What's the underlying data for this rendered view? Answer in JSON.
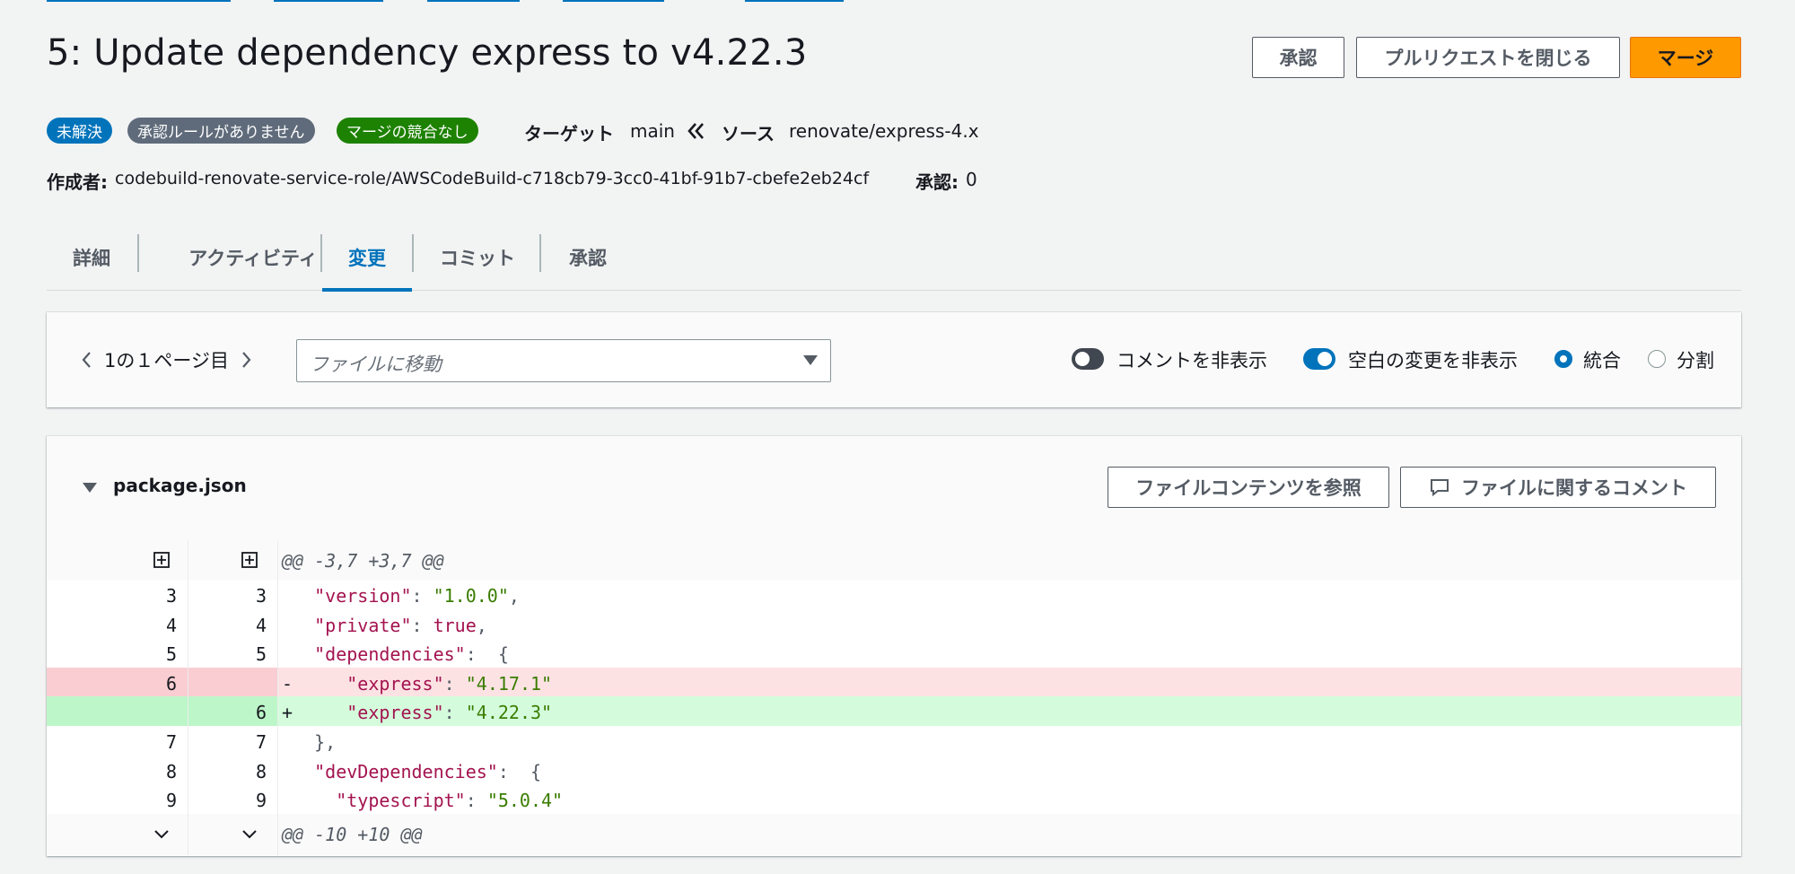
{
  "title": "5: Update dependency express to v4.22.3",
  "actions": {
    "approve": "承認",
    "close_pr": "プルリクエストを閉じる",
    "merge": "マージ"
  },
  "status": {
    "badges": [
      {
        "label": "未解決",
        "color": "#0073bb"
      },
      {
        "label": "承認ルールがありません",
        "color": "#5f6b7a"
      },
      {
        "label": "マージの競合なし",
        "color": "#1d8102"
      }
    ],
    "target_label": "ターゲット",
    "target_branch": "main",
    "source_label": "ソース",
    "source_branch": "renovate/express-4.x",
    "author_label": "作成者:",
    "author": "codebuild-renovate-service-role/AWSCodeBuild-c718cb79-3cc0-41bf-91b7-cbefe2eb24cf",
    "approvals_label": "承認:",
    "approvals_count": "0"
  },
  "tabs": [
    "詳細",
    "アクティビティ",
    "変更",
    "コミット",
    "承認"
  ],
  "active_tab": "変更",
  "toolbar": {
    "pager": "1の１ページ目",
    "file_select_placeholder": "ファイルに移動",
    "hide_comments": {
      "label": "コメントを非表示",
      "on": false
    },
    "hide_whitespace": {
      "label": "空白の変更を非表示",
      "on": true
    },
    "view_unified": "統合",
    "view_split": "分割",
    "selected_view": "統合"
  },
  "file": {
    "name": "package.json",
    "browse_button": "ファイルコンテンツを参照",
    "comment_button": "ファイルに関するコメント"
  },
  "diff": {
    "hunk_header": "@@ -3,7 +3,7 @@",
    "hunk_footer": "@@ -10 +10 @@",
    "lines": [
      {
        "type": "context",
        "old": "3",
        "new": "3",
        "marker": "",
        "indent": "  ",
        "key": "\"version\"",
        "value": "\"1.0.0\"",
        "tail": ","
      },
      {
        "type": "context",
        "old": "4",
        "new": "4",
        "marker": "",
        "indent": "  ",
        "key": "\"private\"",
        "value": "true",
        "tail": ","
      },
      {
        "type": "context",
        "old": "5",
        "new": "5",
        "marker": "",
        "indent": "  ",
        "key": "\"dependencies\"",
        "value": "",
        "tail": "{"
      },
      {
        "type": "del",
        "old": "6",
        "new": "",
        "marker": "-",
        "indent": "    ",
        "key": "\"express\"",
        "value": "\"4.17.1\"",
        "tail": ""
      },
      {
        "type": "add",
        "old": "",
        "new": "6",
        "marker": "+",
        "indent": "    ",
        "key": "\"express\"",
        "value": "\"4.22.3\"",
        "tail": ""
      },
      {
        "type": "context",
        "old": "7",
        "new": "7",
        "marker": "",
        "indent": "  ",
        "key": "",
        "value": "",
        "tail": "},"
      },
      {
        "type": "context",
        "old": "8",
        "new": "8",
        "marker": "",
        "indent": "  ",
        "key": "\"devDependencies\"",
        "value": "",
        "tail": "{"
      },
      {
        "type": "context",
        "old": "9",
        "new": "9",
        "marker": "",
        "indent": "    ",
        "key": "\"typescript\"",
        "value": "\"5.0.4\"",
        "tail": ""
      }
    ]
  }
}
